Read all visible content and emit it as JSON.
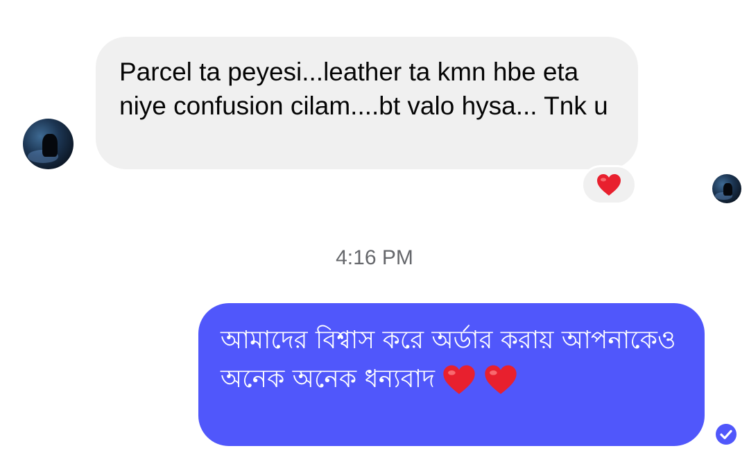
{
  "conversation": {
    "incoming": {
      "text": "Parcel ta peyesi...leather ta kmn hbe eta niye confusion cilam....bt valo hysa... Tnk u",
      "avatar_icon": "profile-photo-dark-blue",
      "reaction": "heart"
    },
    "timestamp": "4:16 PM",
    "outgoing": {
      "text": "আমাদের বিশ্বাস করে অর্ডার করায় আপনাকেও অনেক অনেক ধন্যবাদ",
      "emojis": [
        "heart",
        "heart"
      ],
      "status_icon": "sent-check-icon"
    }
  },
  "colors": {
    "incoming_bubble": "#f0f0f0",
    "outgoing_bubble": "#5057fb",
    "heart": "#e8202e",
    "timestamp": "#65676b"
  }
}
